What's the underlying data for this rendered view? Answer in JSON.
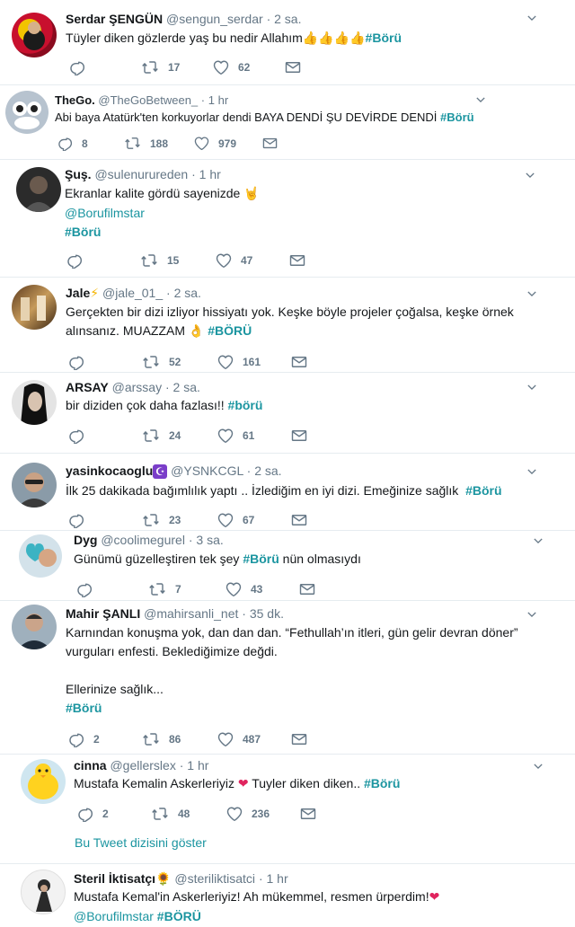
{
  "tweets": [
    {
      "name": "Serdar ŞENGÜN",
      "handle": "@sengun_serdar",
      "time": "2 sa.",
      "text": "Tüyler diken gözlerde yaş bu nedir Allahım",
      "emoji": "👍👍👍👍",
      "tag": "#Börü",
      "reply": "",
      "retweet": "17",
      "like": "62"
    },
    {
      "name": "TheGo.",
      "handle": "@TheGoBetween_",
      "time": "1 hr",
      "text": "Abi baya Atatürk'ten korkuyorlar dendi BAYA DENDİ ŞU DEVİRDE DENDİ",
      "tag": "#Börü",
      "reply": "8",
      "retweet": "188",
      "like": "979"
    },
    {
      "name": "Şuş.",
      "handle": "@sulenurureden",
      "time": "1 hr",
      "line1": "Ekranlar kalite gördü sayenizde",
      "emoji": "🤘",
      "mention": "@Borufilmstar",
      "tag": "#Börü",
      "reply": "",
      "retweet": "15",
      "like": "47"
    },
    {
      "name": "Jale",
      "name_emoji": "⚡",
      "handle": "@jale_01_",
      "time": "2 sa.",
      "line1": "Gerçekten bir dizi izliyor hissiyatı yok. Keşke böyle projeler çoğalsa, keşke örnek",
      "line2": "alınsanız. MUAZZAM",
      "emoji": "👌",
      "tag": "#BÖRÜ",
      "reply": "",
      "retweet": "52",
      "like": "161"
    },
    {
      "name": "ARSAY",
      "handle": "@arssay",
      "time": "2 sa.",
      "text": "bir diziden çok daha fazlası!!",
      "tag": "#börü",
      "reply": "",
      "retweet": "24",
      "like": "61"
    },
    {
      "name": "yasinkocaoglu",
      "name_emoji": "☪",
      "handle": "@YSNKCGL",
      "time": "2 sa.",
      "text": "İlk 25 dakikada bağımlılık yaptı .. İzlediğim en iyi dizi. Emeğinize sağlık",
      "tag": "#Börü",
      "reply": "",
      "retweet": "23",
      "like": "67"
    },
    {
      "name": "Dyg",
      "handle": "@coolimegurel",
      "time": "3 sa.",
      "text": "Günümü güzelleştiren tek şey",
      "tag": "#Börü",
      "suffix": "nün olmasıydı",
      "reply": "",
      "retweet": "7",
      "like": "43"
    },
    {
      "name": "Mahir ŞANLI",
      "handle": "@mahirsanli_net",
      "time": "35 dk.",
      "line1": "Karnından konuşma yok, dan dan dan. “Fethullah’ın itleri, gün gelir devran döner”",
      "line2": "vurguları enfesti. Beklediğimize değdi.",
      "line3": "Ellerinize sağlık...",
      "tag": "#Börü",
      "reply": "2",
      "retweet": "86",
      "like": "487"
    },
    {
      "name": "cinna",
      "handle": "@gellerslex",
      "time": "1 hr",
      "text": "Mustafa Kemalin Askerleriyiz",
      "emoji": "❤",
      "suffix": "Tuyler diken diken..",
      "tag": "#Börü",
      "reply": "2",
      "retweet": "48",
      "like": "236",
      "show_thread": "Bu Tweet dizisini göster"
    },
    {
      "name": "Steril İktisatçı",
      "name_emoji": "🌻",
      "handle": "@steriliktisatci",
      "time": "1 hr",
      "text": "Mustafa Kemal'in Askerleriyiz! Ah mükemmel, resmen ürperdim!",
      "emoji": "❤",
      "mention": "@Borufilmstar",
      "tag": "#BÖRÜ"
    }
  ],
  "dot": "·",
  "colors": {
    "accent": "#1b95a0",
    "muted": "#657786",
    "heart": "#e0245e",
    "divider": "#e6ecf0"
  }
}
